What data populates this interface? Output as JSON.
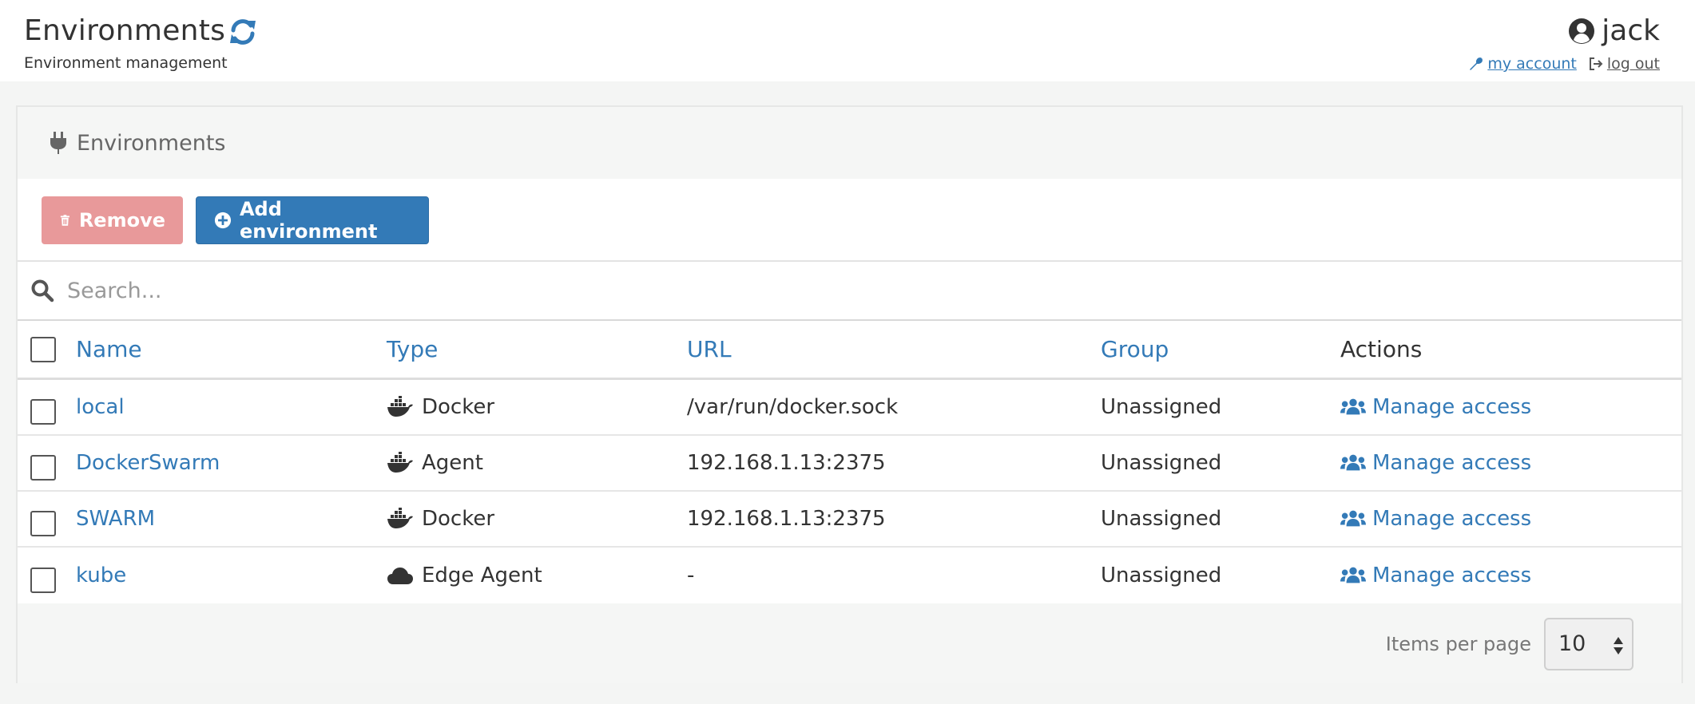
{
  "header": {
    "title": "Environments",
    "subtitle": "Environment management",
    "user": "jack",
    "my_account": "my account",
    "log_out": "log out"
  },
  "widget": {
    "title": "Environments",
    "remove_label": "Remove",
    "add_label": "Add environment",
    "search_placeholder": "Search..."
  },
  "table": {
    "columns": [
      "Name",
      "Type",
      "URL",
      "Group",
      "Actions"
    ],
    "rows": [
      {
        "name": "local",
        "type": "Docker",
        "type_icon": "docker-icon",
        "url": "/var/run/docker.sock",
        "group": "Unassigned",
        "action": "Manage access"
      },
      {
        "name": "DockerSwarm",
        "type": "Agent",
        "type_icon": "docker-icon",
        "url": "192.168.1.13:2375",
        "group": "Unassigned",
        "action": "Manage access"
      },
      {
        "name": "SWARM",
        "type": "Docker",
        "type_icon": "docker-icon",
        "url": "192.168.1.13:2375",
        "group": "Unassigned",
        "action": "Manage access"
      },
      {
        "name": "kube",
        "type": "Edge Agent",
        "type_icon": "cloud-icon",
        "url": "-",
        "group": "Unassigned",
        "action": "Manage access"
      }
    ]
  },
  "pagination": {
    "items_per_page_label": "Items per page",
    "items_per_page_value": "10"
  },
  "colors": {
    "accent": "#337ab7",
    "remove_button": "#e8999a",
    "page_bg": "#f4f5f4"
  }
}
